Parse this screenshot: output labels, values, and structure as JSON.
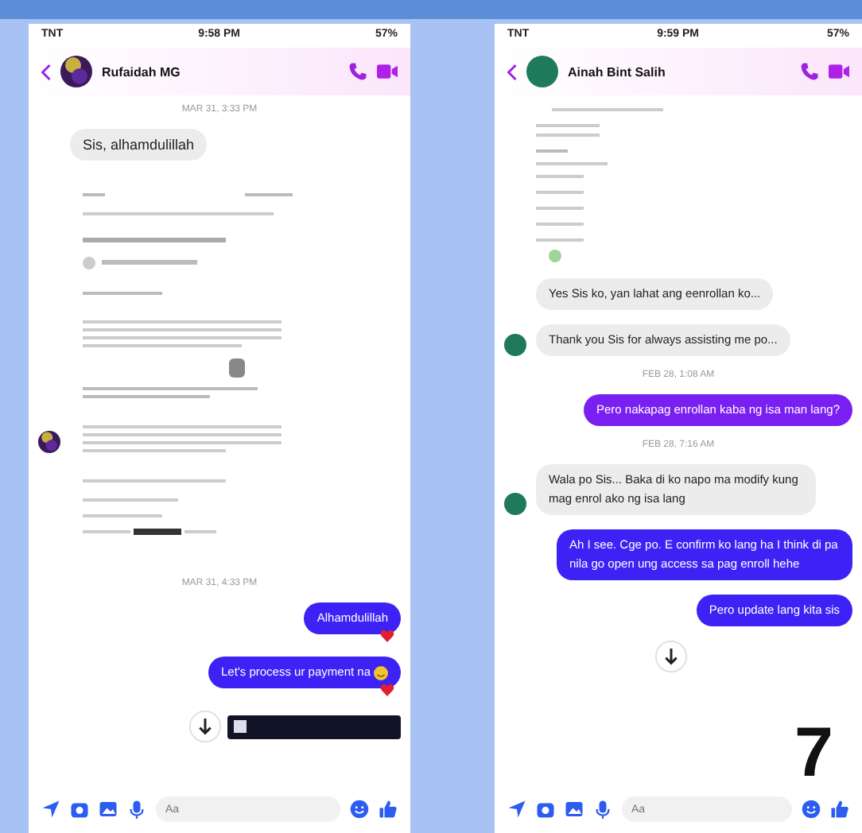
{
  "phones": [
    {
      "status": {
        "carrier": "TNT",
        "time": "9:58 PM",
        "battery": "57%"
      },
      "contact": {
        "name": "Rufaidah MG"
      },
      "messages": [
        {
          "kind": "time",
          "text": "MAR 31, 3:33 PM"
        },
        {
          "kind": "in",
          "text": "Sis, alhamdulillah",
          "avatar": false
        },
        {
          "kind": "document",
          "avatar": true
        },
        {
          "kind": "time",
          "text": "MAR 31, 4:33 PM"
        },
        {
          "kind": "out",
          "text": "Alhamdulillah",
          "color": "#3d22f5",
          "reaction": true,
          "emoji": false
        },
        {
          "kind": "out",
          "text": "Let's process ur payment na",
          "color": "#3d22f5",
          "reaction": true,
          "emoji": true
        },
        {
          "kind": "scroll",
          "banner": true
        }
      ],
      "composer": {
        "placeholder": "Aa"
      }
    },
    {
      "status": {
        "carrier": "TNT",
        "time": "9:59 PM",
        "battery": "57%"
      },
      "contact": {
        "name": "Ainah Bint Salih",
        "kind": "plain"
      },
      "messages": [
        {
          "kind": "list"
        },
        {
          "kind": "in",
          "text": "Yes Sis ko, yan lahat ang eenrollan ko...",
          "avatar": false
        },
        {
          "kind": "in",
          "text": "Thank you Sis for always assisting me po...",
          "avatar": true
        },
        {
          "kind": "time",
          "text": "FEB 28, 1:08 AM"
        },
        {
          "kind": "out",
          "text": "Pero nakapag enrollan kaba ng isa man lang?",
          "color": "#7a1ff2",
          "reaction": false,
          "emoji": false
        },
        {
          "kind": "time",
          "text": "FEB 28, 7:16 AM"
        },
        {
          "kind": "in",
          "text": "Wala po Sis... Baka di ko napo ma modify kung mag enrol ako ng isa lang",
          "avatar": true
        },
        {
          "kind": "out",
          "text": "Ah I see. Cge po. E confirm ko lang ha I think di pa nila go open ung access sa pag enroll hehe",
          "color": "#3d22f5",
          "reaction": false,
          "emoji": false
        },
        {
          "kind": "out",
          "text": "Pero update lang kita sis",
          "color": "#3d22f5",
          "reaction": false,
          "emoji": false
        },
        {
          "kind": "scroll",
          "banner": false
        }
      ],
      "composer": {
        "placeholder": "Aa"
      }
    }
  ],
  "overlay_number": "7"
}
